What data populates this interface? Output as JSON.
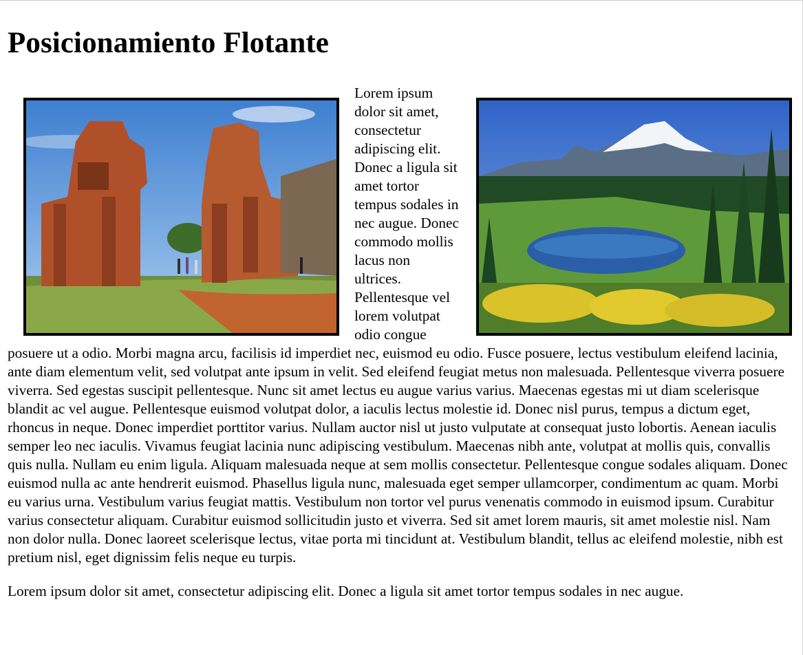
{
  "page": {
    "title": "Posicionamiento Flotante"
  },
  "images": {
    "left": {
      "icon": "ruins-photo"
    },
    "right": {
      "icon": "mountain-lake-photo"
    }
  },
  "paragraphs": [
    "Lorem ipsum dolor sit amet, consectetur adipiscing elit. Donec a ligula sit amet tortor tempus sodales in nec augue. Donec commodo mollis lacus non ultrices. Pellentesque vel lorem volutpat odio congue posuere ut a odio. Morbi magna arcu, facilisis id imperdiet nec, euismod eu odio. Fusce posuere, lectus vestibulum eleifend lacinia, ante diam elementum velit, sed volutpat ante ipsum in velit. Sed eleifend feugiat metus non malesuada. Pellentesque viverra posuere viverra. Sed egestas suscipit pellentesque. Nunc sit amet lectus eu augue varius varius. Maecenas egestas mi ut diam scelerisque blandit ac vel augue. Pellentesque euismod volutpat dolor, a iaculis lectus molestie id. Donec nisl purus, tempus a dictum eget, rhoncus in neque. Donec imperdiet porttitor varius. Nullam auctor nisl ut justo vulputate at consequat justo lobortis. Aenean iaculis semper leo nec iaculis. Vivamus feugiat lacinia nunc adipiscing vestibulum. Maecenas nibh ante, volutpat at mollis quis, convallis quis nulla. Nullam eu enim ligula. Aliquam malesuada neque at sem mollis consectetur. Pellentesque congue sodales aliquam. Donec euismod nulla ac ante hendrerit euismod. Phasellus ligula nunc, malesuada eget semper ullamcorper, condimentum ac quam. Morbi eu varius urna. Vestibulum varius feugiat mattis. Vestibulum non tortor vel purus venenatis commodo in euismod ipsum. Curabitur varius consectetur aliquam. Curabitur euismod sollicitudin justo et viverra. Sed sit amet lorem mauris, sit amet molestie nisl. Nam non dolor nulla. Donec laoreet scelerisque lectus, vitae porta mi tincidunt at. Vestibulum blandit, tellus ac eleifend molestie, nibh est pretium nisl, eget dignissim felis neque eu turpis.",
    "Lorem ipsum dolor sit amet, consectetur adipiscing elit. Donec a ligula sit amet tortor tempus sodales in nec augue."
  ]
}
